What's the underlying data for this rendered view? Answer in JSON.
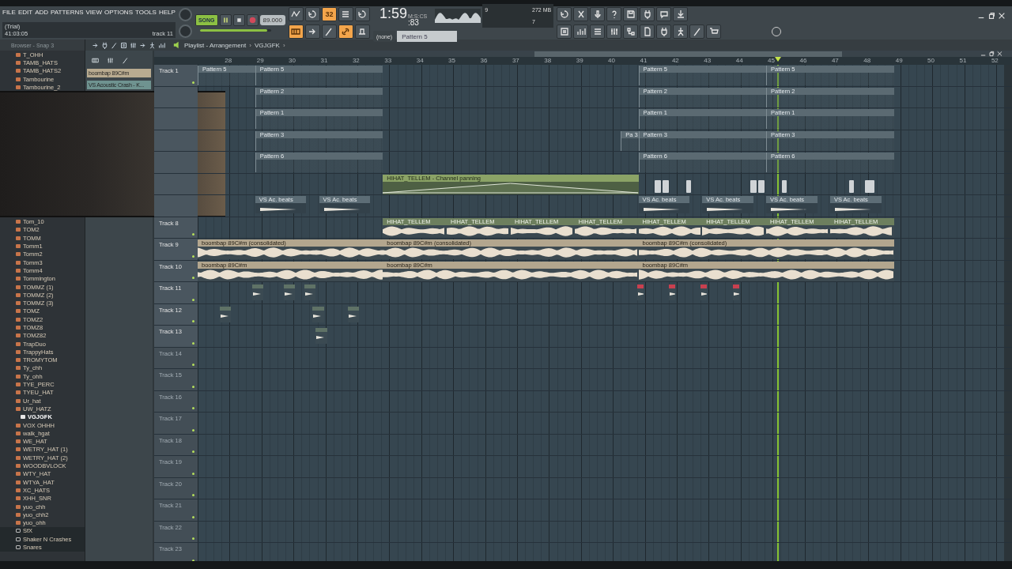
{
  "menu": [
    "FILE",
    "EDIT",
    "ADD",
    "PATTERNS",
    "VIEW",
    "OPTIONS",
    "TOOLS",
    "HELP"
  ],
  "hint": {
    "title": "(Trial)",
    "value": "41:03:05",
    "target": "track 11"
  },
  "transport": {
    "mode": "SONG",
    "song_mode": true,
    "tempo": "89.000",
    "time": "1:59",
    "time_fraction": ":83",
    "time_unit": "M:S:CS",
    "volume": {
      "level": 0.95
    }
  },
  "monitor": {
    "cpu": "9",
    "memory": "272 MB",
    "polyphony": "7"
  },
  "tools_top": [
    {
      "kind": "zigzag",
      "on": false
    },
    {
      "kind": "loop",
      "on": false
    },
    {
      "kind": "step",
      "label": "32",
      "on": true
    },
    {
      "kind": "stack",
      "on": false
    },
    {
      "kind": "loop",
      "on": false
    }
  ],
  "tools_right": [
    {
      "kind": "loop",
      "on": false
    },
    {
      "kind": "scissors",
      "on": false
    },
    {
      "kind": "microphone",
      "on": false
    },
    {
      "kind": "question",
      "on": false
    },
    {
      "kind": "floppy",
      "on": false
    },
    {
      "kind": "plug",
      "on": false
    },
    {
      "kind": "bubble",
      "on": false
    },
    {
      "kind": "download",
      "on": false
    }
  ],
  "tools_bottom": [
    {
      "kind": "keyboard",
      "on": true
    },
    {
      "kind": "arrow",
      "on": false
    },
    {
      "kind": "brush",
      "on": false
    },
    {
      "kind": "link",
      "on": true
    },
    {
      "kind": "hat",
      "on": false
    }
  ],
  "pattern": {
    "arrangement": "(none)",
    "pattern": "Pattern 5"
  },
  "tools_windows": [
    {
      "kind": "list",
      "on": false
    },
    {
      "kind": "bars",
      "on": false
    },
    {
      "kind": "stack",
      "on": false
    },
    {
      "kind": "sliders",
      "on": false
    },
    {
      "kind": "tree",
      "on": false
    },
    {
      "kind": "document",
      "on": false
    },
    {
      "kind": "plug",
      "on": false
    },
    {
      "kind": "figure",
      "on": false
    },
    {
      "kind": "brush",
      "on": false
    },
    {
      "kind": "cart",
      "on": false
    }
  ],
  "browser": {
    "title": "Browser - Snap 3",
    "items": [
      {
        "label": "T_OHH",
        "kind": "pack",
        "selected": false
      },
      {
        "label": "TAMB_HATS",
        "kind": "pack",
        "selected": false
      },
      {
        "label": "TAMB_HATS2",
        "kind": "pack",
        "selected": false
      },
      {
        "label": "Tambourine",
        "kind": "pack",
        "selected": false
      },
      {
        "label": "Tambourine_2",
        "kind": "pack",
        "selected": false
      },
      {
        "label": "Tom_10",
        "kind": "pack",
        "selected": false
      },
      {
        "label": "TOM2",
        "kind": "pack",
        "selected": false
      },
      {
        "label": "TOMM",
        "kind": "pack",
        "selected": false
      },
      {
        "label": "Tomm1",
        "kind": "pack",
        "selected": false
      },
      {
        "label": "Tomm2",
        "kind": "pack",
        "selected": false
      },
      {
        "label": "Tomm3",
        "kind": "pack",
        "selected": false
      },
      {
        "label": "Tomm4",
        "kind": "pack",
        "selected": false
      },
      {
        "label": "Tommington",
        "kind": "pack",
        "selected": false
      },
      {
        "label": "TOMMZ (1)",
        "kind": "pack",
        "selected": false
      },
      {
        "label": "TOMMZ (2)",
        "kind": "pack",
        "selected": false
      },
      {
        "label": "TOMMZ (3)",
        "kind": "pack",
        "selected": false
      },
      {
        "label": "TOMZ",
        "kind": "pack",
        "selected": false
      },
      {
        "label": "TOMZ2",
        "kind": "pack",
        "selected": false
      },
      {
        "label": "TOMZ8",
        "kind": "pack",
        "selected": false
      },
      {
        "label": "TOMZ82",
        "kind": "pack",
        "selected": false
      },
      {
        "label": "TrapDuo",
        "kind": "pack",
        "selected": false
      },
      {
        "label": "TrappyHats",
        "kind": "pack",
        "selected": false
      },
      {
        "label": "TROMYTOM",
        "kind": "pack",
        "selected": false
      },
      {
        "label": "Ty_chh",
        "kind": "pack",
        "selected": false
      },
      {
        "label": "Ty_ohh",
        "kind": "pack",
        "selected": false
      },
      {
        "label": "TYE_PERC",
        "kind": "pack",
        "selected": false
      },
      {
        "label": "TYEU_HAT",
        "kind": "pack",
        "selected": false
      },
      {
        "label": "Ur_hat",
        "kind": "pack",
        "selected": false
      },
      {
        "label": "UW_HATZ",
        "kind": "pack",
        "selected": false
      },
      {
        "label": "VGJGFK",
        "kind": "pack",
        "selected": true
      },
      {
        "label": "VOX OHHH",
        "kind": "pack",
        "selected": false
      },
      {
        "label": "walk_hgat",
        "kind": "pack",
        "selected": false
      },
      {
        "label": "WE_HAT",
        "kind": "pack",
        "selected": false
      },
      {
        "label": "WETRY_HAT (1)",
        "kind": "pack",
        "selected": false
      },
      {
        "label": "WETRY_HAT (2)",
        "kind": "pack",
        "selected": false
      },
      {
        "label": "WOODBVLOCK",
        "kind": "pack",
        "selected": false
      },
      {
        "label": "WTY_HAT",
        "kind": "pack",
        "selected": false
      },
      {
        "label": "WTYA_HAT",
        "kind": "pack",
        "selected": false
      },
      {
        "label": "XC_HATS",
        "kind": "pack",
        "selected": false
      },
      {
        "label": "XHH_SNR",
        "kind": "pack",
        "selected": false
      },
      {
        "label": "yuo_chh",
        "kind": "pack",
        "selected": false
      },
      {
        "label": "yuo_chh2",
        "kind": "pack",
        "selected": false
      },
      {
        "label": "yuo_ohh",
        "kind": "pack",
        "selected": false
      },
      {
        "label": "SfX",
        "kind": "folder",
        "selected": false
      },
      {
        "label": "Shaker N Crashes",
        "kind": "folder",
        "selected": false
      },
      {
        "label": "Snares",
        "kind": "folder",
        "selected": false
      }
    ]
  },
  "picker": [
    {
      "label": "boombap 89C#m",
      "color": "#b9ab90"
    },
    {
      "label": "VS Acoustic Crash - K...",
      "color": "#6f9390"
    }
  ],
  "playlist": {
    "title": "Playlist - Arrangement",
    "separator": "›",
    "arrangement": "VGJGFK",
    "ruler": [
      "28",
      "29",
      "30",
      "31",
      "32",
      "33",
      "34",
      "35",
      "36",
      "37",
      "38",
      "39",
      "40",
      "41",
      "42",
      "43",
      "44",
      "45",
      "46",
      "47",
      "48",
      "49",
      "50",
      "51",
      "52"
    ],
    "tracks": [
      {
        "label": "Track 1",
        "empty": false,
        "clips": [
          {
            "kind": "pattern",
            "label": "Pattern 5"
          },
          {
            "kind": "pattern",
            "label": "Pattern 5"
          },
          {
            "kind": "pattern",
            "label": "Pattern 5"
          },
          {
            "kind": "pattern",
            "label": "Pattern 5"
          }
        ]
      },
      {
        "clips": [
          {
            "kind": "pattern",
            "label": "Pattern 2"
          },
          {
            "kind": "pattern",
            "label": "Pattern 2"
          },
          {
            "kind": "pattern",
            "label": "Pattern 2"
          }
        ]
      },
      {
        "clips": [
          {
            "kind": "pattern",
            "label": "Pattern 1"
          },
          {
            "kind": "pattern",
            "label": "Pattern 1"
          },
          {
            "kind": "pattern",
            "label": "Pattern 1"
          }
        ]
      },
      {
        "clips": [
          {
            "kind": "pattern",
            "label": "Pattern 3"
          },
          {
            "kind": "pattern",
            "label": "Pa 3"
          },
          {
            "kind": "pattern",
            "label": "Pattern 3"
          },
          {
            "kind": "pattern",
            "label": "Pattern 3"
          }
        ]
      },
      {
        "clips": [
          {
            "kind": "pattern",
            "label": "Pattern 6"
          },
          {
            "kind": "pattern",
            "label": "Pattern 6"
          },
          {
            "kind": "pattern",
            "label": "Pattern 6"
          }
        ]
      },
      {
        "clips": [
          {
            "kind": "automation",
            "label": "HIHAT_TELLEM - Channel panning"
          },
          {
            "kind": "slice"
          },
          {
            "kind": "slice"
          },
          {
            "kind": "slice"
          },
          {
            "kind": "slice"
          },
          {
            "kind": "slice"
          },
          {
            "kind": "slice"
          },
          {
            "kind": "slice"
          },
          {
            "kind": "slice"
          }
        ]
      },
      {
        "clips": [
          {
            "kind": "sample",
            "label": "VS Ac. beats"
          },
          {
            "kind": "sample",
            "label": "VS Ac. beats"
          },
          {
            "kind": "sample",
            "label": "VS Ac. beats"
          },
          {
            "kind": "sample",
            "label": "VS Ac. beats"
          },
          {
            "kind": "sample",
            "label": "VS Ac. beats"
          },
          {
            "kind": "sample",
            "label": "VS Ac. beats"
          }
        ]
      },
      {
        "label": "Track 8",
        "empty": false,
        "clips": [
          {
            "kind": "hihat",
            "label": "HIHAT_TELLEM"
          },
          {
            "kind": "hihat",
            "label": "HIHAT_TELLEM"
          },
          {
            "kind": "hihat",
            "label": "HIHAT_TELLEM"
          },
          {
            "kind": "hihat",
            "label": "HIHAT_TELLEM"
          },
          {
            "kind": "hihat",
            "label": "HIHAT_TELLEM"
          },
          {
            "kind": "hihat",
            "label": "HIHAT_TELLEM"
          },
          {
            "kind": "hihat",
            "label": "HIHAT_TELLEM"
          },
          {
            "kind": "hihat",
            "label": "HIHAT_TELLEM"
          }
        ]
      },
      {
        "label": "Track 9",
        "empty": false,
        "clips": [
          {
            "kind": "audio",
            "label": "boombap 89C#m (consolidated)"
          },
          {
            "kind": "audio",
            "label": "boombap 89C#m (consolidated)"
          },
          {
            "kind": "audio",
            "label": "boombap 89C#m (consolidated)"
          }
        ]
      },
      {
        "label": "Track 10",
        "empty": false,
        "clips": [
          {
            "kind": "audio",
            "label": "boombap 89C#m"
          },
          {
            "kind": "audio",
            "label": "boombap 89C#m"
          },
          {
            "kind": "audio",
            "label": "boombap 89C#m"
          }
        ]
      },
      {
        "label": "Track 11",
        "empty": false,
        "clips": [
          {
            "kind": "hit",
            "color": "#5f7266"
          },
          {
            "kind": "hit",
            "color": "#5f7266"
          },
          {
            "kind": "hit",
            "color": "#5f7266"
          },
          {
            "kind": "hit",
            "color": "#c8404f"
          },
          {
            "kind": "hit",
            "color": "#c8404f"
          },
          {
            "kind": "hit",
            "color": "#c8404f"
          },
          {
            "kind": "hit",
            "color": "#c8404f"
          }
        ]
      },
      {
        "label": "Track 12",
        "empty": false,
        "clips": [
          {
            "kind": "hit",
            "color": "#5f7266"
          },
          {
            "kind": "hit",
            "color": "#5f7266"
          },
          {
            "kind": "hit",
            "color": "#5f7266"
          }
        ]
      },
      {
        "label": "Track 13",
        "empty": false,
        "clips": [
          {
            "kind": "hit",
            "color": "#5f7266"
          }
        ]
      },
      {
        "label": "Track 14",
        "empty": true
      },
      {
        "label": "Track 15",
        "empty": true
      },
      {
        "label": "Track 16",
        "empty": true
      },
      {
        "label": "Track 17",
        "empty": true
      },
      {
        "label": "Track 18",
        "empty": true
      },
      {
        "label": "Track 19",
        "empty": true
      },
      {
        "label": "Track 20",
        "empty": true
      },
      {
        "label": "Track 21",
        "empty": true
      },
      {
        "label": "Track 22",
        "empty": true
      },
      {
        "label": "Track 23",
        "empty": true
      }
    ]
  }
}
